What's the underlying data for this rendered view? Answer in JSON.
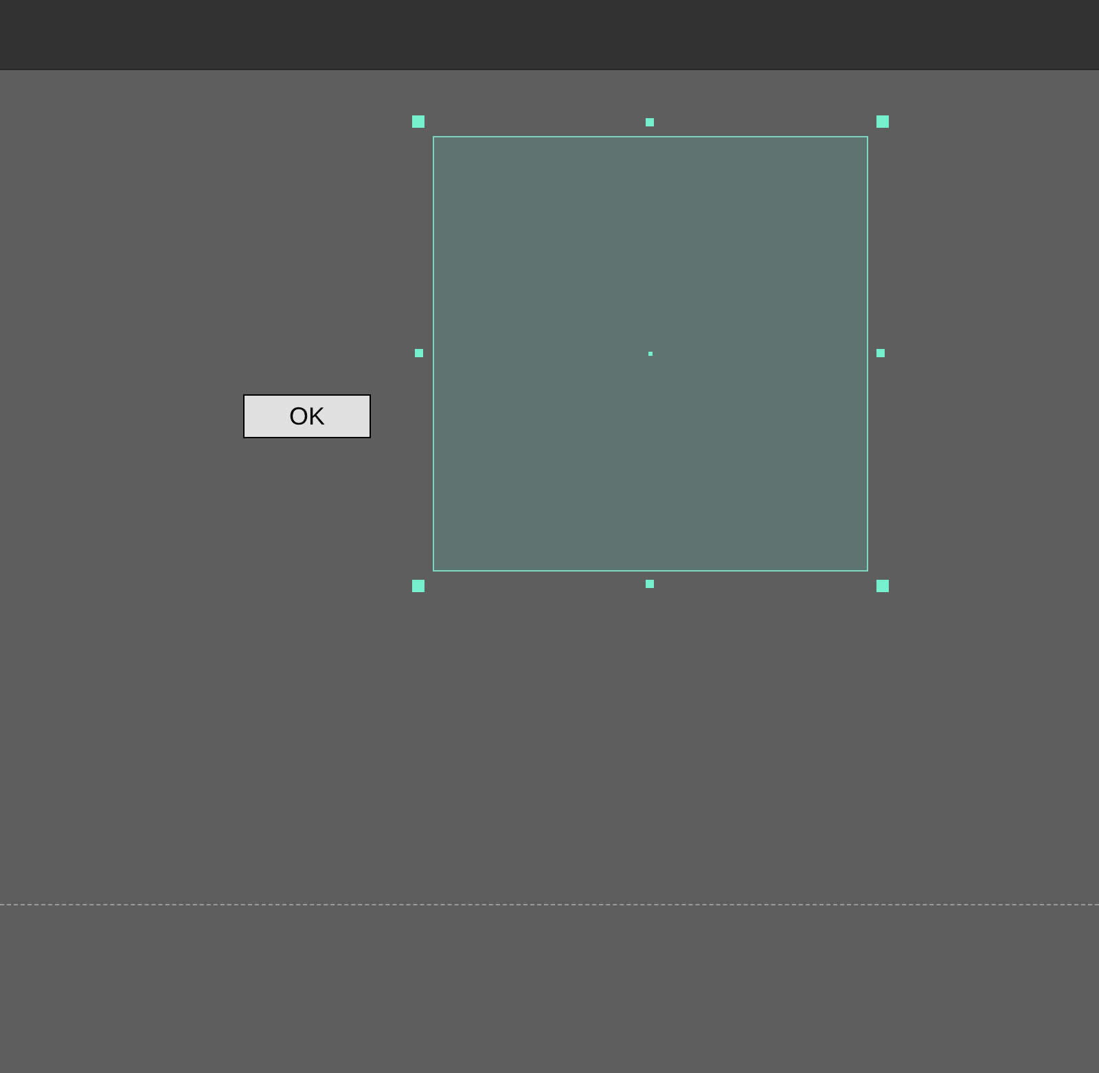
{
  "button": {
    "label": "OK"
  }
}
